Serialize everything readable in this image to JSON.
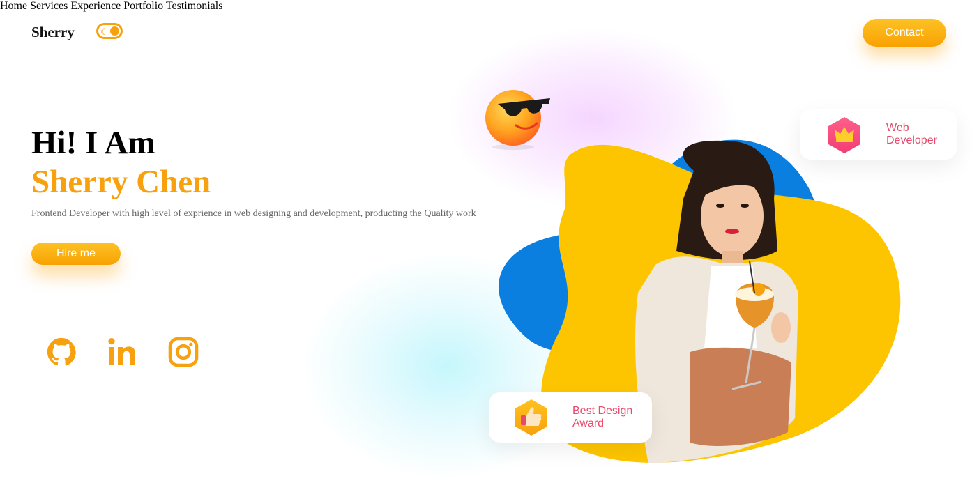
{
  "header": {
    "logo": "Sherry",
    "theme_toggle_icon": "moon-icon",
    "nav": [
      "Home",
      "Services",
      "Experience",
      "Portfolio",
      "Testimonials"
    ],
    "contact_label": "Contact"
  },
  "hero": {
    "greeting": "Hi! I Am",
    "name": "Sherry Chen",
    "description": "Frontend Developer with high level of exprience in web designing and development, producting the Quality work",
    "hire_label": "Hire me"
  },
  "social": [
    "github-icon",
    "linkedin-icon",
    "instagram-icon"
  ],
  "badges": {
    "web": {
      "line1": "Web",
      "line2": "Developer",
      "icon": "crown-icon"
    },
    "award": {
      "line1": "Best Design",
      "line2": "Award",
      "icon": "thumbs-up-icon"
    }
  },
  "colors": {
    "accent": "#f7a10f",
    "blob_yellow": "#fdc500",
    "blob_blue": "#0a7fe0",
    "badge_text": "#e84a6c"
  }
}
